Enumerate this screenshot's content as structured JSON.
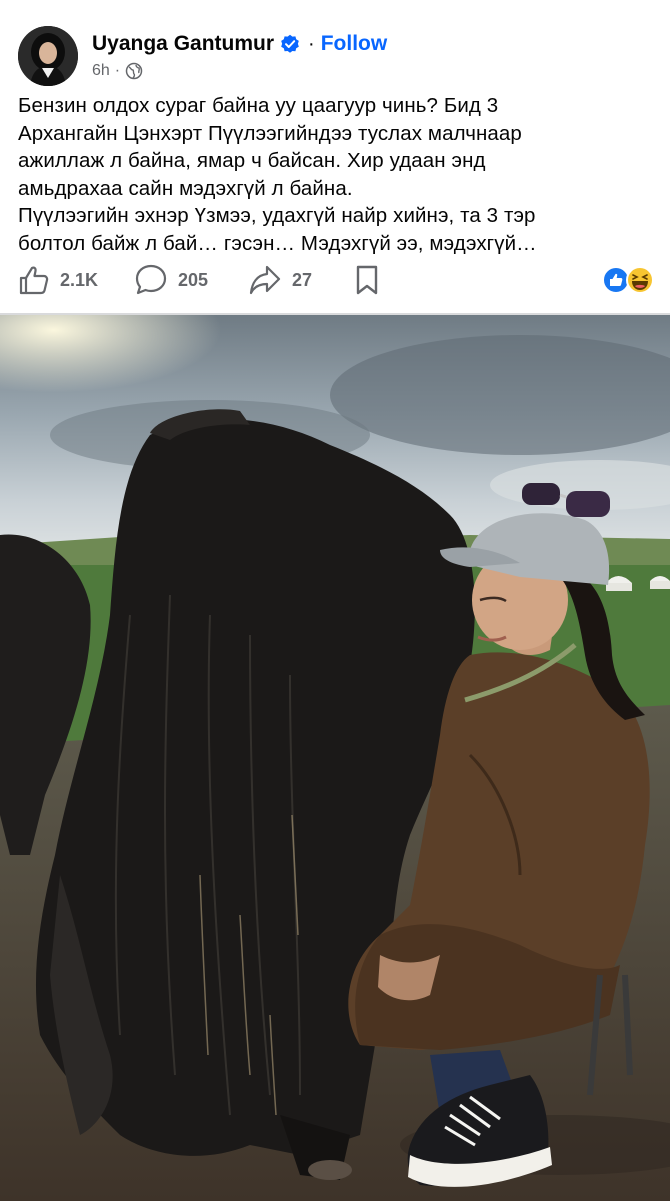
{
  "post": {
    "author": "Uyanga Gantumur",
    "follow_label": "Follow",
    "separator": "·",
    "time": "6h",
    "time_dot": "·",
    "text_lines": [
      "Бензин олдох сураг байна уу цаагуур чинь? Бид 3",
      "Архангайн Цэнхэрт Пүүлээгийндээ туслах малчнаар",
      "ажиллаж л байна, ямар ч байсан. Хир удаан энд",
      "амьдрахаа сайн мэдэхгүй л байна.",
      "Пүүлээгийн эхнэр Үзмээ, удахгүй найр хийнэ, та 3 тэр",
      "болтол байж л бай… гэсэн… Мэдэхгүй ээ, мэдэхгүй…"
    ]
  },
  "actions": {
    "likes": "2.1K",
    "comments": "205",
    "shares": "27"
  },
  "icons": {
    "verified": "verified-badge-icon",
    "privacy": "globe-icon",
    "like": "thumbs-up-icon",
    "comment": "comment-bubble-icon",
    "share": "share-arrow-icon",
    "save": "bookmark-icon",
    "reaction_like": "like-reaction-icon",
    "reaction_haha": "haha-reaction-icon"
  },
  "colors": {
    "accent": "#0866ff",
    "muted": "#65676b",
    "text": "#050505"
  }
}
